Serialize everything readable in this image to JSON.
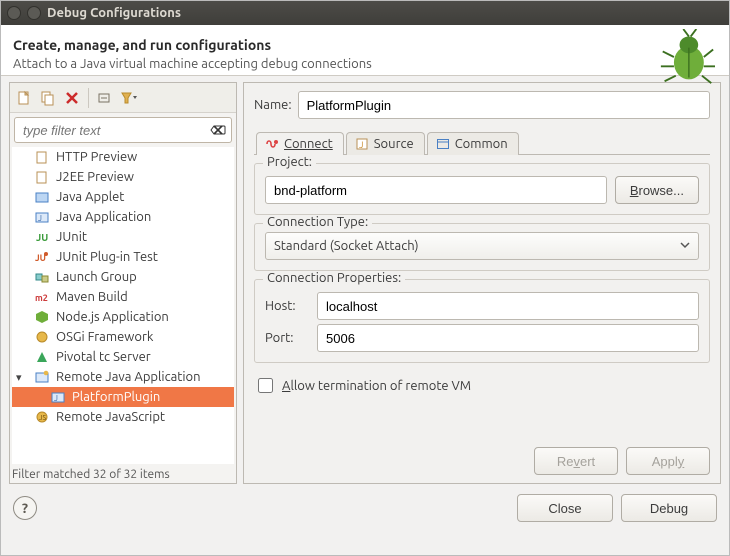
{
  "window": {
    "title": "Debug Configurations"
  },
  "header": {
    "title": "Create, manage, and run configurations",
    "subtitle": "Attach to a Java virtual machine accepting debug connections"
  },
  "filter": {
    "placeholder": "type filter text",
    "status": "Filter matched 32 of 32 items"
  },
  "tree": [
    {
      "label": "HTTP Preview",
      "icon": "http"
    },
    {
      "label": "J2EE Preview",
      "icon": "j2ee"
    },
    {
      "label": "Java Applet",
      "icon": "applet"
    },
    {
      "label": "Java Application",
      "icon": "java"
    },
    {
      "label": "JUnit",
      "icon": "junit"
    },
    {
      "label": "JUnit Plug-in Test",
      "icon": "junit-plugin"
    },
    {
      "label": "Launch Group",
      "icon": "launch-group"
    },
    {
      "label": "Maven Build",
      "icon": "maven"
    },
    {
      "label": "Node.js Application",
      "icon": "node"
    },
    {
      "label": "OSGi Framework",
      "icon": "osgi"
    },
    {
      "label": "Pivotal tc Server",
      "icon": "pivotal"
    },
    {
      "label": "Remote Java Application",
      "icon": "remote-java",
      "expanded": true,
      "children": [
        {
          "label": "PlatformPlugin",
          "icon": "java",
          "selected": true
        }
      ]
    },
    {
      "label": "Remote JavaScript",
      "icon": "remote-js"
    }
  ],
  "form": {
    "name_label": "Name:",
    "name_value": "PlatformPlugin",
    "tabs": {
      "connect": "Connect",
      "source": "Source",
      "common": "Common"
    },
    "project": {
      "group": "Project:",
      "value": "bnd-platform",
      "browse": "Browse..."
    },
    "connection_type": {
      "group": "Connection Type:",
      "selected": "Standard (Socket Attach)"
    },
    "connection_props": {
      "group": "Connection Properties:",
      "host_label": "Host:",
      "host_value": "localhost",
      "port_label": "Port:",
      "port_value": "5006"
    },
    "allow_term_label": "Allow termination of remote VM",
    "allow_term_checked": false,
    "revert": "Revert",
    "apply": "Apply"
  },
  "footer": {
    "close": "Close",
    "debug": "Debug"
  }
}
